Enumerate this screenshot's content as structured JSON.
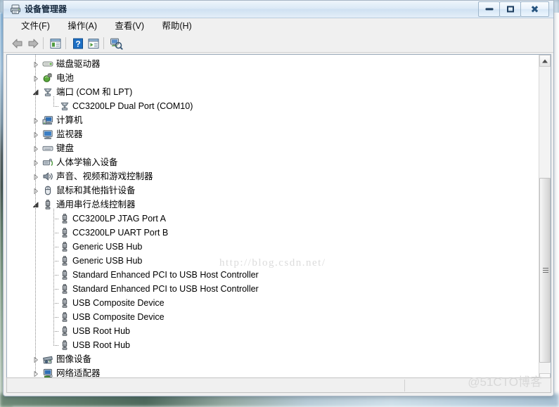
{
  "window": {
    "title": "设备管理器",
    "title_icon": "device-manager-icon",
    "buttons": {
      "minimize": "最小化",
      "maximize": "最大化",
      "close": "关闭"
    }
  },
  "menubar": {
    "items": [
      {
        "label": "文件(F)",
        "name": "menu-file"
      },
      {
        "label": "操作(A)",
        "name": "menu-action"
      },
      {
        "label": "查看(V)",
        "name": "menu-view"
      },
      {
        "label": "帮助(H)",
        "name": "menu-help"
      }
    ]
  },
  "toolbar": {
    "items": [
      {
        "name": "back-icon",
        "title": "后退"
      },
      {
        "name": "forward-icon",
        "title": "前进"
      },
      {
        "name": "properties-icon",
        "title": "属性"
      },
      {
        "name": "help-icon",
        "title": "帮助"
      },
      {
        "name": "update-driver-icon",
        "title": "更新驱动程序软件"
      },
      {
        "name": "scan-hardware-icon",
        "title": "扫描检测硬件改动"
      }
    ]
  },
  "tree": {
    "rows": [
      {
        "label": "磁盘驱动器",
        "depth": 1,
        "state": "collapsed",
        "icon": "disk-drive-icon"
      },
      {
        "label": "电池",
        "depth": 1,
        "state": "collapsed",
        "icon": "battery-icon"
      },
      {
        "label": "端口 (COM 和 LPT)",
        "depth": 1,
        "state": "expanded",
        "icon": "port-icon"
      },
      {
        "label": "CC3200LP Dual Port (COM10)",
        "depth": 2,
        "state": "leaf",
        "icon": "port-icon"
      },
      {
        "label": "计算机",
        "depth": 1,
        "state": "collapsed",
        "icon": "computer-icon"
      },
      {
        "label": "监视器",
        "depth": 1,
        "state": "collapsed",
        "icon": "monitor-icon"
      },
      {
        "label": "键盘",
        "depth": 1,
        "state": "collapsed",
        "icon": "keyboard-icon"
      },
      {
        "label": "人体学输入设备",
        "depth": 1,
        "state": "collapsed",
        "icon": "hid-icon"
      },
      {
        "label": "声音、视频和游戏控制器",
        "depth": 1,
        "state": "collapsed",
        "icon": "sound-icon"
      },
      {
        "label": "鼠标和其他指针设备",
        "depth": 1,
        "state": "collapsed",
        "icon": "mouse-icon"
      },
      {
        "label": "通用串行总线控制器",
        "depth": 1,
        "state": "expanded",
        "icon": "usb-icon"
      },
      {
        "label": "CC3200LP JTAG Port A",
        "depth": 2,
        "state": "leaf",
        "icon": "usb-icon"
      },
      {
        "label": "CC3200LP UART Port B",
        "depth": 2,
        "state": "leaf",
        "icon": "usb-icon"
      },
      {
        "label": "Generic USB Hub",
        "depth": 2,
        "state": "leaf",
        "icon": "usb-icon"
      },
      {
        "label": "Generic USB Hub",
        "depth": 2,
        "state": "leaf",
        "icon": "usb-icon"
      },
      {
        "label": "Standard Enhanced PCI to USB Host Controller",
        "depth": 2,
        "state": "leaf",
        "icon": "usb-icon"
      },
      {
        "label": "Standard Enhanced PCI to USB Host Controller",
        "depth": 2,
        "state": "leaf",
        "icon": "usb-icon"
      },
      {
        "label": "USB Composite Device",
        "depth": 2,
        "state": "leaf",
        "icon": "usb-icon"
      },
      {
        "label": "USB Composite Device",
        "depth": 2,
        "state": "leaf",
        "icon": "usb-icon"
      },
      {
        "label": "USB Root Hub",
        "depth": 2,
        "state": "leaf",
        "icon": "usb-icon"
      },
      {
        "label": "USB Root Hub",
        "depth": 2,
        "state": "leaf",
        "icon": "usb-icon"
      },
      {
        "label": "图像设备",
        "depth": 1,
        "state": "collapsed",
        "icon": "imaging-icon"
      },
      {
        "label": "网络适配器",
        "depth": 1,
        "state": "collapsed",
        "icon": "network-adapter-icon"
      }
    ]
  },
  "scrollbar": {
    "up_arrow": "scroll-up-icon",
    "down_arrow": "scroll-down-icon"
  },
  "statusbar": {
    "text": ""
  },
  "watermarks": {
    "csdn": "http://blog.csdn.net/",
    "cto": "@51CTO博客"
  },
  "colors": {
    "title_bar": "#dbe9f6",
    "window_chrome": "#f0f0f0",
    "client_bg": "#ffffff",
    "text": "#000000",
    "watermark": "#dcdcdc",
    "frame_border": "#9babbb"
  }
}
